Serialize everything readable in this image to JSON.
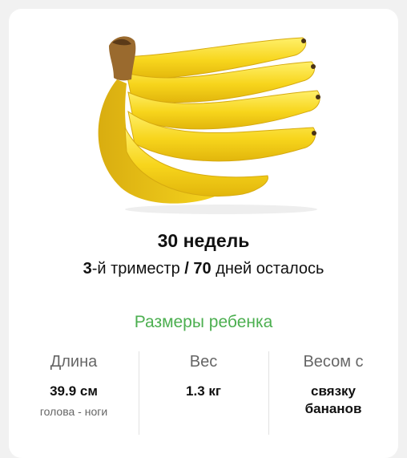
{
  "header": {
    "image": "banana-bunch",
    "week_title": "30 недель",
    "trimester_number": "3",
    "trimester_text": "-й триместр ",
    "separator": "/",
    "days_number": "70",
    "days_text": " дней осталось"
  },
  "sizes": {
    "title": "Размеры ребенка",
    "accent_color": "#4caf50",
    "items": [
      {
        "label": "Длина",
        "value": "39.9 см",
        "note": "голова - ноги"
      },
      {
        "label": "Вес",
        "value": "1.3 кг",
        "note": ""
      },
      {
        "label": "Весом с",
        "value_line1": "связку",
        "value_line2": "бананов"
      }
    ]
  }
}
